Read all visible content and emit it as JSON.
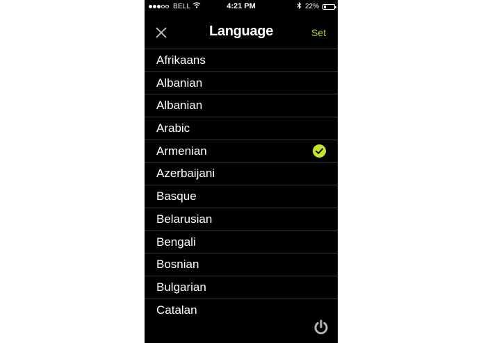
{
  "status_bar": {
    "signal_dots": [
      true,
      true,
      true,
      false,
      false
    ],
    "carrier": "BELL",
    "time": "4:21 PM",
    "battery": "22%",
    "battery_level": 0.22,
    "icons": [
      "wifi-icon",
      "bluetooth-icon",
      "battery-icon"
    ]
  },
  "header": {
    "title": "Language",
    "set_label": "Set",
    "close_icon": "close-icon"
  },
  "languages": [
    {
      "label": "Afrikaans",
      "selected": false
    },
    {
      "label": "Albanian",
      "selected": false
    },
    {
      "label": "Albanian",
      "selected": false
    },
    {
      "label": "Arabic",
      "selected": false
    },
    {
      "label": "Armenian",
      "selected": true
    },
    {
      "label": "Azerbaijani",
      "selected": false
    },
    {
      "label": "Basque",
      "selected": false
    },
    {
      "label": "Belarusian",
      "selected": false
    },
    {
      "label": "Bengali",
      "selected": false
    },
    {
      "label": "Bosnian",
      "selected": false
    },
    {
      "label": "Bulgarian",
      "selected": false
    },
    {
      "label": "Catalan",
      "selected": false
    }
  ],
  "footer": {
    "power_icon": "power-icon"
  },
  "colors": {
    "accent": "#b5d334",
    "check": "#c8e42a",
    "background": "#000000",
    "divider": "#3a3a3a",
    "text": "#ffffff"
  }
}
